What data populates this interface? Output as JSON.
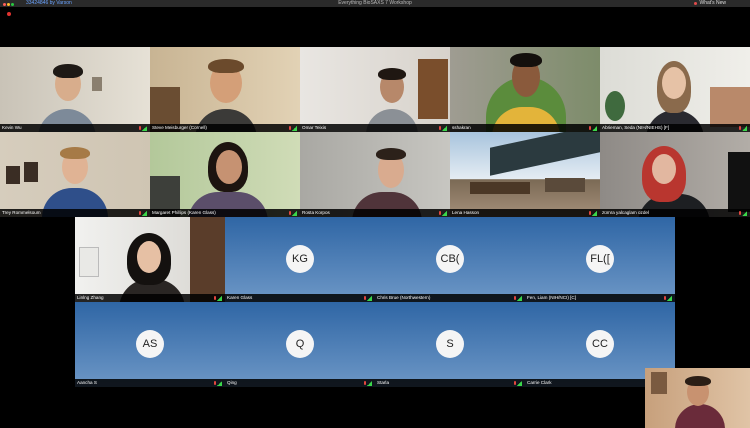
{
  "window": {
    "title": "Everything BioSAXS 7 Workshop",
    "top_left": "33424846 by Varson",
    "whats_new": "What's New"
  },
  "participants": [
    {
      "name": "Kevin Wu",
      "type": "video"
    },
    {
      "name": "Steve Meisburger (Cornell)",
      "type": "video"
    },
    {
      "name": "Omar Teixis",
      "type": "video"
    },
    {
      "name": "sshakran",
      "type": "video"
    },
    {
      "name": "Abrieman, Seda (NIH/NIEHS) [F]",
      "type": "video"
    },
    {
      "name": "Trey Rommelsoum",
      "type": "video"
    },
    {
      "name": "Margaret Phillips (Karen Glass)",
      "type": "video"
    },
    {
      "name": "Rosta Korpos",
      "type": "video"
    },
    {
      "name": "Lena Hasson",
      "type": "video"
    },
    {
      "name": "zümra yalcaglam ozdel",
      "type": "video"
    },
    {
      "name": "Linlng Zhang",
      "type": "video"
    },
    {
      "name": "Karen Glass",
      "type": "avatar",
      "initials": "KG"
    },
    {
      "name": "Chris Brue (Northwestern)",
      "type": "avatar",
      "initials": "CB("
    },
    {
      "name": "Fen, Liam (NIH/NCI) [C]",
      "type": "avatar",
      "initials": "FL(["
    },
    {
      "name": "Aancha S",
      "type": "avatar",
      "initials": "AS"
    },
    {
      "name": "Qing",
      "type": "avatar",
      "initials": "Q"
    },
    {
      "name": "Starla",
      "type": "avatar",
      "initials": "S"
    },
    {
      "name": "Carrie Clark",
      "type": "avatar",
      "initials": "CC"
    }
  ],
  "colors": {
    "mic_muted": "#e2463f",
    "signal": "#3ad64a",
    "avatar_top": "#2f66a5",
    "avatar_bottom": "#6d97c6",
    "record": "#e0332f"
  }
}
